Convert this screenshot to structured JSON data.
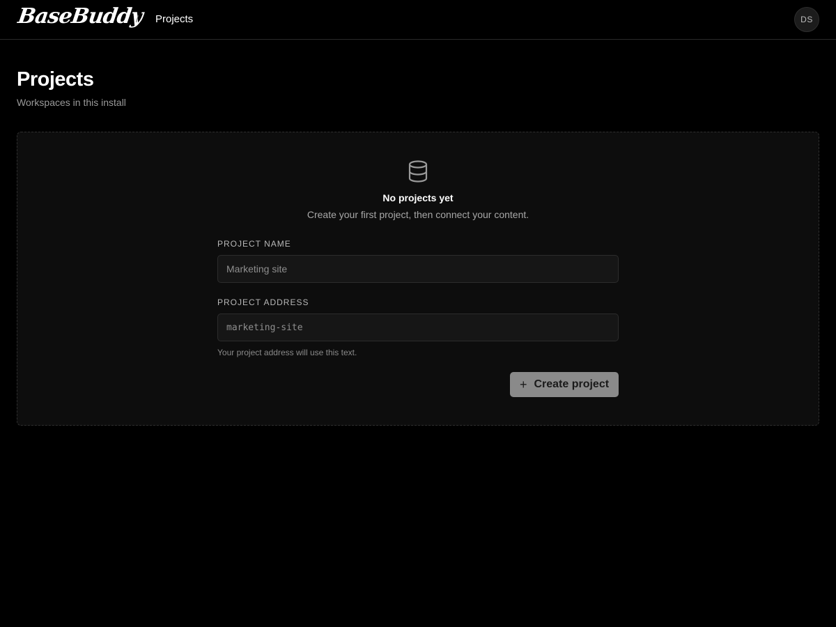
{
  "header": {
    "logo_text": "BaseBuddy",
    "breadcrumb_separator": "/",
    "breadcrumb_current": "Projects",
    "avatar_initials": "DS"
  },
  "page": {
    "title": "Projects",
    "subtitle": "Workspaces in this install"
  },
  "empty_state": {
    "icon": "database-icon",
    "title": "No projects yet",
    "description": "Create your first project, then connect your content."
  },
  "form": {
    "name_label": "PROJECT NAME",
    "name_placeholder": "Marketing site",
    "address_label": "PROJECT ADDRESS",
    "address_placeholder": "marketing-site",
    "address_hint": "Your project address will use this text.",
    "create_label": "Create project",
    "create_icon": "plus-icon"
  },
  "colors": {
    "background": "#000000",
    "panel": "#0d0d0d",
    "button": "#8a8a8a"
  }
}
